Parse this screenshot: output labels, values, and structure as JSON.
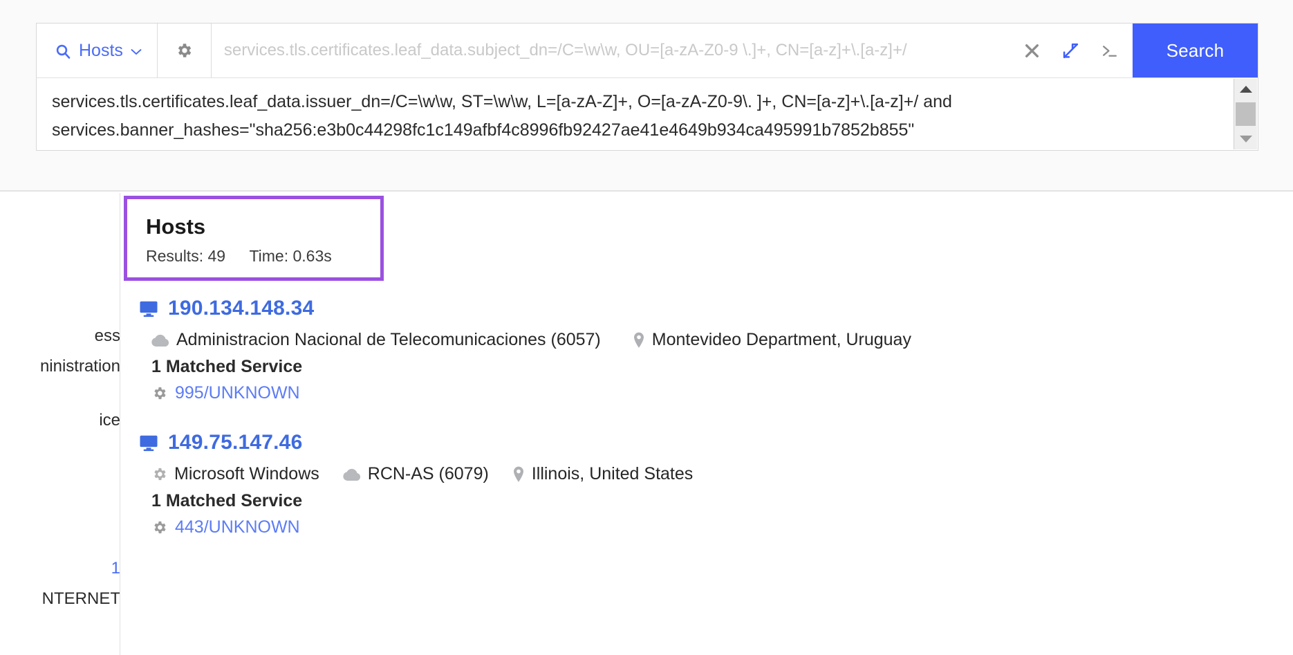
{
  "search": {
    "scope_label": "Hosts",
    "scope_icon": "search-icon",
    "settings_icon": "gear-icon",
    "placeholder": "services.tls.certificates.leaf_data.subject_dn=/C=\\w\\w, OU=[a-zA-Z0-9 \\.]+, CN=[a-z]+\\.[a-z]+/",
    "input_value": "",
    "clear_icon": "close-icon",
    "collapse_icon": "collapse-arrows-icon",
    "terminal_icon": "terminal-prompt-icon",
    "search_button": "Search"
  },
  "query": {
    "line1": "services.tls.certificates.leaf_data.issuer_dn=/C=\\w\\w, ST=\\w\\w, L=[a-zA-Z]+, O=[a-zA-Z0-9\\. ]+, CN=[a-z]+\\.[a-z]+/ and",
    "line2": "services.banner_hashes=\"sha256:e3b0c44298fc1c149afbf4c8996fb92427ae41e4649b934ca495991b7852b855\""
  },
  "sidebar": {
    "clipped_items": [
      "ess",
      "ninistration",
      "",
      "ice"
    ],
    "clipped_items_lower": [
      "1",
      "NTERNET"
    ]
  },
  "summary": {
    "title": "Hosts",
    "results_label": "Results: 49",
    "time_label": "Time: 0.63s",
    "highlight_color": "#9B51E0"
  },
  "hosts": [
    {
      "ip": "190.134.148.34",
      "device_icon": "monitor-icon",
      "os": null,
      "os_icon": "gear-icon",
      "autonomous_system": "Administracion Nacional de Telecomunicaciones (6057)",
      "as_icon": "cloud-icon",
      "location": "Montevideo Department, Uruguay",
      "location_icon": "map-pin-icon",
      "matched_services_label": "1 Matched Service",
      "services": [
        {
          "label": "995/UNKNOWN",
          "icon": "gear-icon"
        }
      ]
    },
    {
      "ip": "149.75.147.46",
      "device_icon": "monitor-icon",
      "os": "Microsoft Windows",
      "os_icon": "gear-icon",
      "autonomous_system": "RCN-AS (6079)",
      "as_icon": "cloud-icon",
      "location": "Illinois, United States",
      "location_icon": "map-pin-icon",
      "matched_services_label": "1 Matched Service",
      "services": [
        {
          "label": "443/UNKNOWN",
          "icon": "gear-icon"
        }
      ]
    }
  ],
  "colors": {
    "accent_blue": "#3F5EFB",
    "link_blue": "#3F6BE0",
    "service_blue": "#5C7CF5",
    "highlight_purple": "#9B51E0"
  }
}
